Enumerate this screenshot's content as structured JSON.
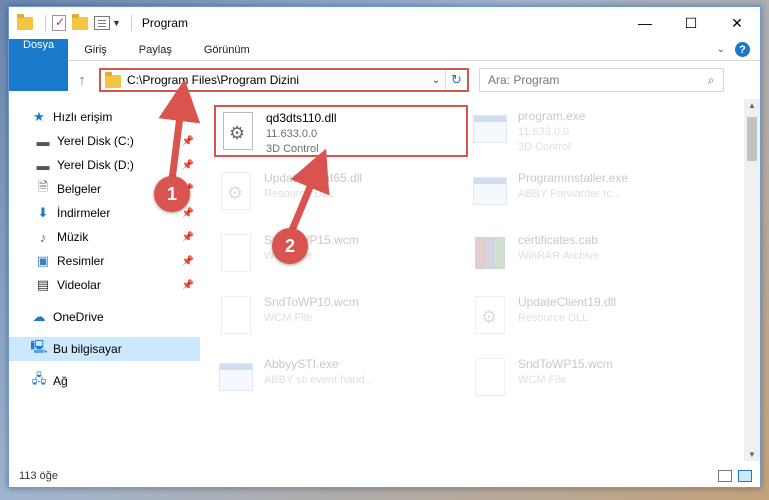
{
  "window": {
    "title": "Program"
  },
  "ribbon": {
    "tabs": [
      "Dosya",
      "Giriş",
      "Paylaş",
      "Görünüm"
    ]
  },
  "address": {
    "path": "C:\\Program Files\\Program Dizini"
  },
  "search": {
    "placeholder": "Ara: Program"
  },
  "sidebar": {
    "quick_access": "Hızlı erişim",
    "pinned": [
      "Yerel Disk (C:)",
      "Yerel Disk (D:)",
      "Belgeler",
      "İndirmeler",
      "Müzik",
      "Resimler",
      "Videolar"
    ],
    "onedrive": "OneDrive",
    "this_pc": "Bu bilgisayar",
    "network": "Ağ"
  },
  "files": [
    {
      "name": "qd3dts110.dll",
      "line1": "11.633.0.0",
      "line2": "3D Control",
      "icon": "dll-gear-icon"
    },
    {
      "name": "program.exe",
      "line1": "11.633.0.0",
      "line2": "3D Control",
      "icon": "exe-icon"
    },
    {
      "name": "UpdateClient65.dll",
      "line1": "Resource DLL",
      "line2": "",
      "icon": "dll-gear-icon"
    },
    {
      "name": "Programınstaller.exe",
      "line1": "ABBY Forwarder tc...",
      "line2": "",
      "icon": "installer-icon"
    },
    {
      "name": "SndToWP15.wcm",
      "line1": "WCM File",
      "line2": "",
      "icon": "document-icon"
    },
    {
      "name": "certificates.cab",
      "line1": "WinRAR Archive",
      "line2": "",
      "icon": "archive-icon"
    },
    {
      "name": "SndToWP10.wcm",
      "line1": "WCM File",
      "line2": "",
      "icon": "document-icon"
    },
    {
      "name": "UpdateClient19.dll",
      "line1": "Resource DLL",
      "line2": "",
      "icon": "dll-gear-icon"
    },
    {
      "name": "AbbyySTI.exe",
      "line1": "ABBY sti event hand...",
      "line2": "",
      "icon": "exe-icon"
    },
    {
      "name": "SndToWP15.wcm",
      "line1": "WCM File",
      "line2": "",
      "icon": "document-icon"
    }
  ],
  "annotations": {
    "badge1": "1",
    "badge2": "2"
  },
  "status": {
    "count": "113 öğe"
  },
  "colors": {
    "accent": "#1979ca",
    "highlight": "#d9534f",
    "selected": "#cce8ff"
  }
}
